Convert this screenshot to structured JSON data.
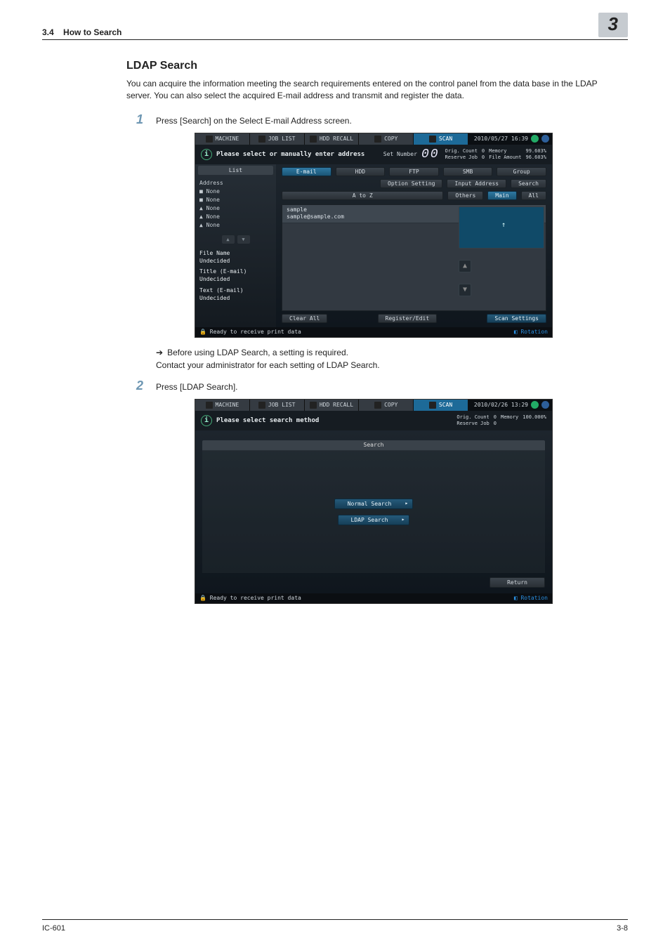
{
  "header": {
    "section_num": "3.4",
    "section_title": "How to Search",
    "chapter_num": "3"
  },
  "section": {
    "title": "LDAP Search",
    "intro": "You can acquire the information meeting the search requirements entered on the control panel from the data base in the LDAP server.  You can also select the acquired E-mail address and transmit and register the data."
  },
  "steps": {
    "s1": {
      "num": "1",
      "text": "Press [Search] on the Select E-mail Address screen."
    },
    "s1_sub_arrow": "➔",
    "s1_sub1": "Before using LDAP Search, a setting is required.",
    "s1_sub2": "Contact your administrator for each setting of LDAP Search.",
    "s2": {
      "num": "2",
      "text": "Press [LDAP Search]."
    }
  },
  "panel1": {
    "tabs": {
      "machine": "MACHINE",
      "joblist": "JOB LIST",
      "hdd": "HDD RECALL",
      "copy": "COPY",
      "scan": "SCAN"
    },
    "timestamp": "2010/05/27 16:39",
    "info_msg": "Please select or manually enter address",
    "set_number_label": "Set Number",
    "set_number_value": "00",
    "stats": {
      "orig_count_l": "Orig. Count",
      "orig_count_v": "0",
      "memory_l": "Memory",
      "memory_v": "99.603%",
      "reserve_l": "Reserve Job",
      "reserve_v": "0",
      "file_l": "File Amount",
      "file_v": "96.603%"
    },
    "side": {
      "list_tab": "List",
      "address_label": "Address",
      "none1": "None",
      "none2": "None",
      "none3": "None",
      "none4": "None",
      "none5": "None",
      "file_name_l": "File Name",
      "file_name_v": "Undecided",
      "title_l": "Title (E-mail)",
      "title_v": "Undecided",
      "text_l": "Text (E-mail)",
      "text_v": "Undecided"
    },
    "row1": {
      "email": "E-mail",
      "hdd": "HDD",
      "ftp": "FTP",
      "smb": "SMB",
      "group": "Group"
    },
    "row2": {
      "option": "Option Setting",
      "input": "Input Address",
      "search": "Search"
    },
    "row3": {
      "atoz": "A to Z",
      "others": "Others",
      "main": "Main",
      "all": "All"
    },
    "list_entry_name": "sample",
    "list_entry_addr": "sample@sample.com",
    "bottom": {
      "clear": "Clear All",
      "regedit": "Register/Edit",
      "scanset": "Scan Settings"
    },
    "statusbar": "Ready to receive print data",
    "rotation": "Rotation"
  },
  "panel2": {
    "tabs": {
      "machine": "MACHINE",
      "joblist": "JOB LIST",
      "hdd": "HDD RECALL",
      "copy": "COPY",
      "scan": "SCAN"
    },
    "timestamp": "2010/02/26 13:29",
    "info_msg": "Please select search method",
    "stats": {
      "orig_count_l": "Orig. Count",
      "orig_count_v": "0",
      "memory_l": "Memory",
      "memory_v": "100.000%",
      "reserve_l": "Reserve Job",
      "reserve_v": "0"
    },
    "search_hdr": "Search",
    "normal_search": "Normal Search",
    "ldap_search": "LDAP Search",
    "return_btn": "Return",
    "statusbar": "Ready to receive print data",
    "rotation": "Rotation"
  },
  "footer": {
    "left": "IC-601",
    "right": "3-8"
  }
}
